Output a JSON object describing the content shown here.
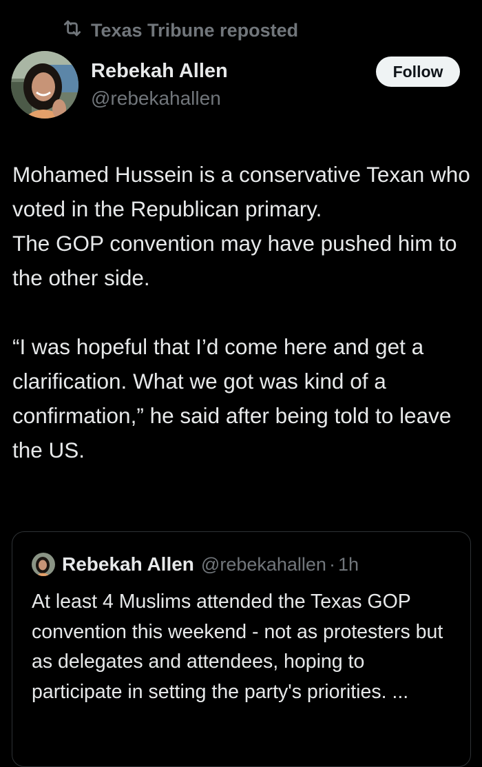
{
  "repost": {
    "icon": "repost-icon",
    "label": "Texas Tribune reposted"
  },
  "author": {
    "name": "Rebekah Allen",
    "handle": "@rebekahallen"
  },
  "follow_label": "Follow",
  "tweet": {
    "paragraphs": [
      "Mohamed Hussein is a conservative Texan who voted in the Republican primary.",
      "The GOP convention may have pushed him to the other side.",
      "“I was hopeful that I’d come here and get a clarification. What we got was kind of a confirmation,” he said after being told to leave the US."
    ]
  },
  "quote": {
    "name": "Rebekah Allen",
    "handle": "@rebekahallen",
    "separator": "·",
    "time": "1h",
    "text": "At least 4 Muslims attended the Texas GOP convention this weekend - not as protesters but as delegates and attendees, hoping to participate in setting the party's priorities. ..."
  },
  "colors": {
    "background": "#000000",
    "text": "#e7e9ea",
    "muted": "#71767b",
    "border": "#2f3336",
    "follow_bg": "#eff3f4"
  }
}
